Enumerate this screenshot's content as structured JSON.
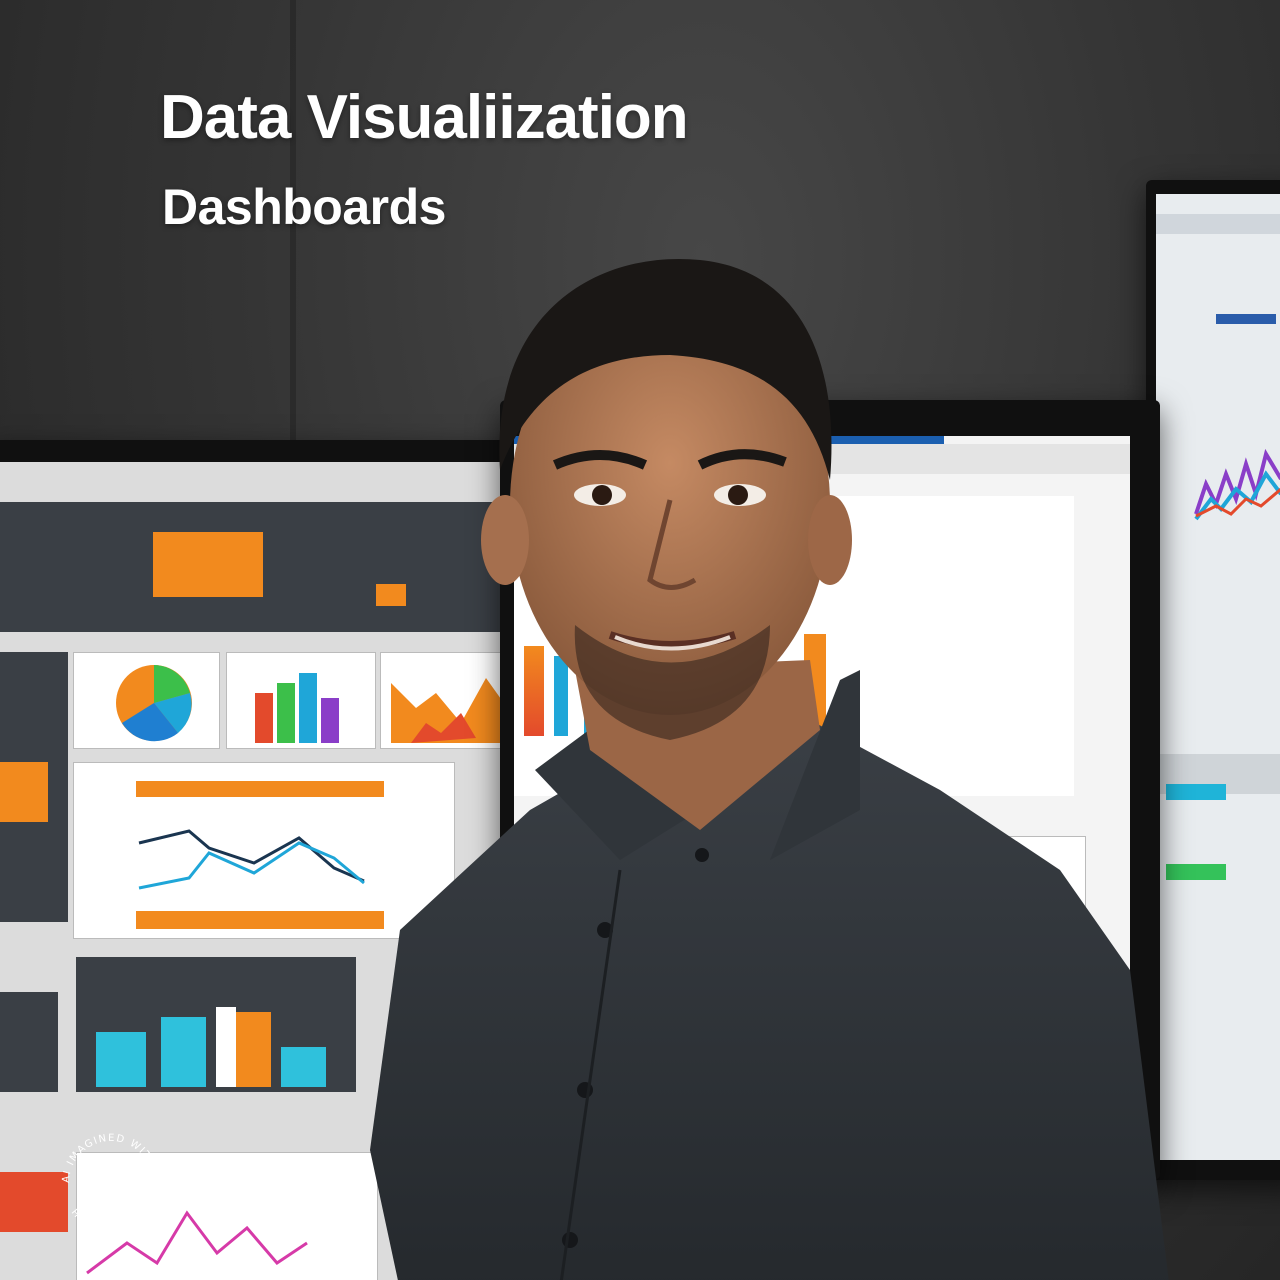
{
  "headline": {
    "title": "Data Visualiization",
    "subtitle": "Dashboards"
  },
  "watermark": {
    "text": "AI IMAGINED WITH AI IMAGINED WITH",
    "icon": "sparkle-person-icon"
  },
  "colors": {
    "accent_orange": "#f28a1e",
    "accent_blue": "#1fa6d8",
    "shirt": "#2d3136",
    "text": "#ffffff"
  }
}
